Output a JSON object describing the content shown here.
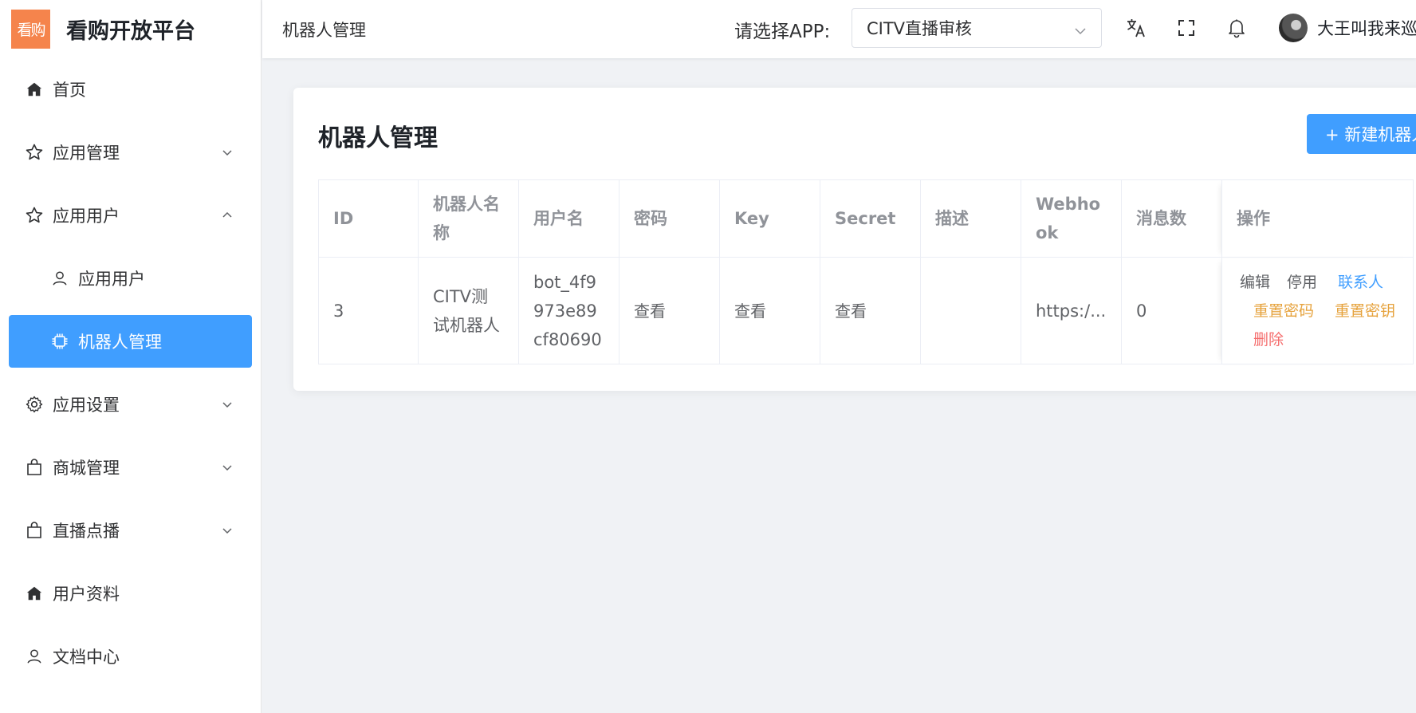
{
  "brand": {
    "logo_text": "看购",
    "title": "看购开放平台"
  },
  "sidebar": {
    "items": [
      {
        "label": "首页",
        "icon": "home-icon"
      },
      {
        "label": "应用管理",
        "icon": "star-icon",
        "arrow": "chevron-down-icon"
      },
      {
        "label": "应用用户",
        "icon": "star-icon",
        "arrow": "chevron-up-icon"
      },
      {
        "label": "应用用户",
        "icon": "user-icon"
      },
      {
        "label": "机器人管理",
        "icon": "chip-icon"
      },
      {
        "label": "应用设置",
        "icon": "gear-icon",
        "arrow": "chevron-down-icon"
      },
      {
        "label": "商城管理",
        "icon": "bag-icon",
        "arrow": "chevron-down-icon"
      },
      {
        "label": "直播点播",
        "icon": "bag-icon",
        "arrow": "chevron-down-icon"
      },
      {
        "label": "用户资料",
        "icon": "home-icon"
      },
      {
        "label": "文档中心",
        "icon": "user-icon"
      }
    ]
  },
  "header": {
    "breadcrumb": "机器人管理",
    "app_label": "请选择APP:",
    "app_value": "CITV直播审核",
    "username": "大王叫我来巡山"
  },
  "main": {
    "title": "机器人管理",
    "new_button": "+ 新建机器人",
    "columns": [
      "ID",
      "机器人名称",
      "用户名",
      "密码",
      "Key",
      "Secret",
      "描述",
      "Webhook",
      "消息数",
      "操作"
    ],
    "rows": [
      {
        "id": "3",
        "name": "CITV测试机器人",
        "username": "bot_4f9973e89cf80690",
        "password": "查看",
        "key": "查看",
        "secret": "查看",
        "desc": "",
        "webhook": "https:/...",
        "messages": "0",
        "ops": {
          "edit": "编辑",
          "disable": "停用",
          "contact": "联系人",
          "reset_pwd": "重置密码",
          "reset_key": "重置密钥",
          "delete": "删除"
        }
      }
    ]
  },
  "colors": {
    "primary": "#409eff",
    "warning": "#e6a23c",
    "danger": "#f56c6c",
    "logo": "#f5844c"
  }
}
